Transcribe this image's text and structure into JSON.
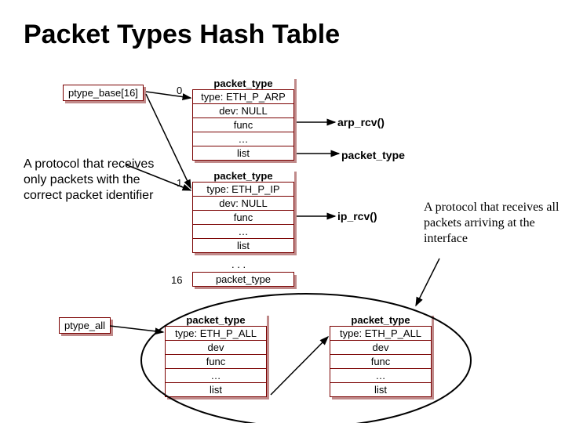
{
  "title": "Packet Types Hash Table",
  "ptype_base": "ptype_base[16]",
  "ptype_all": "ptype_all",
  "note_left": "A protocol that receives only packets with the correct packet identifier",
  "note_right": "A protocol that receives all packets arriving at the interface",
  "idx0": "0",
  "idx1": "1",
  "idx16": "16",
  "arp_rcv": "arp_rcv()",
  "ip_rcv": "ip_rcv()",
  "packet_type_label": "packet_type",
  "struct0": {
    "title": "packet_type",
    "type": "type: ETH_P_ARP",
    "dev": "dev: NULL",
    "func": "func",
    "dots": "…",
    "list": "list"
  },
  "struct1": {
    "title": "packet_type",
    "type": "type: ETH_P_IP",
    "dev": "dev: NULL",
    "func": "func",
    "dots": "…",
    "list": "list"
  },
  "slotDots": ". . .",
  "slot16": "packet_type",
  "structAllLeft": {
    "title": "packet_type",
    "type": "type: ETH_P_ALL",
    "dev": "dev",
    "func": "func",
    "dots": "…",
    "list": "list"
  },
  "structAllRight": {
    "title": "packet_type",
    "type": "type: ETH_P_ALL",
    "dev": "dev",
    "func": "func",
    "dots": "…",
    "list": "list"
  }
}
